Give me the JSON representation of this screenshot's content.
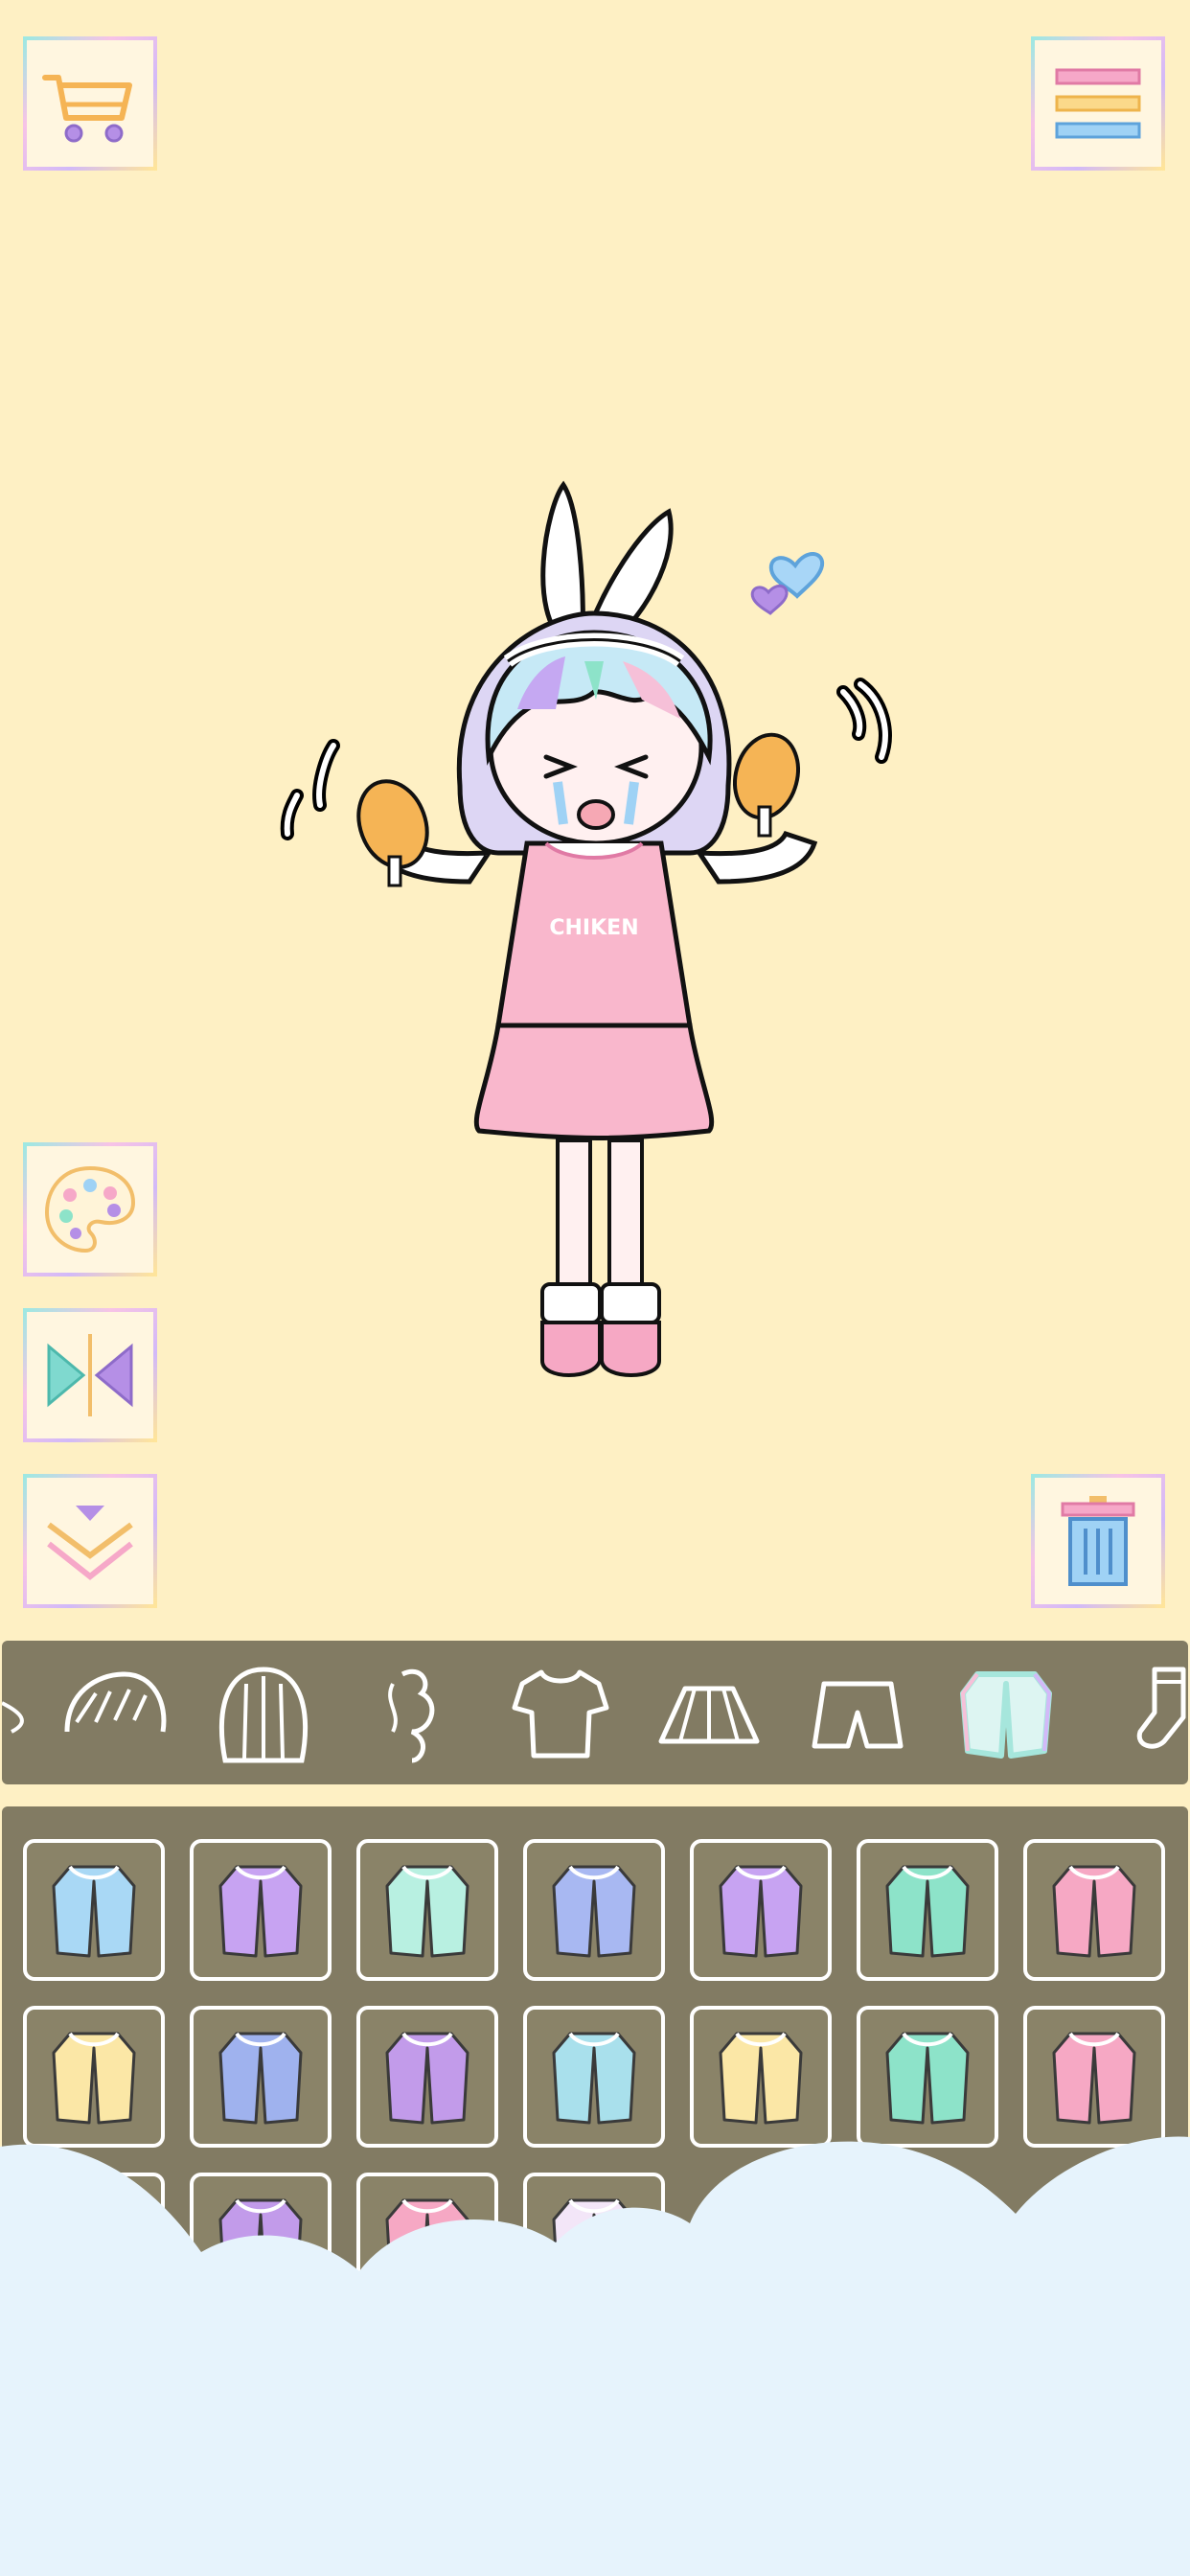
{
  "toolbar": {
    "shop_icon": "cart-icon",
    "menu_icon": "hamburger-menu-icon",
    "palette_icon": "palette-icon",
    "flip_icon": "flip-icon",
    "collapse_icon": "chevron-down-double-icon",
    "trash_icon": "trash-icon"
  },
  "character": {
    "shirt_text": "CHIKEN"
  },
  "categories": [
    {
      "name": "bangs",
      "icon": "bangs-hair-icon"
    },
    {
      "name": "hair-back",
      "icon": "back-hair-icon"
    },
    {
      "name": "hair-accessory",
      "icon": "ponytail-hair-icon"
    },
    {
      "name": "top",
      "icon": "tshirt-icon"
    },
    {
      "name": "skirt",
      "icon": "skirt-icon"
    },
    {
      "name": "shorts",
      "icon": "shorts-icon"
    },
    {
      "name": "outerwear",
      "icon": "jacket-icon",
      "selected": true
    },
    {
      "name": "socks",
      "icon": "socks-icon"
    }
  ],
  "items": [
    {
      "icon": "jacket-item-icon",
      "color": "#A9D8F5"
    },
    {
      "icon": "jacket-item-icon",
      "color": "#C7A3F2"
    },
    {
      "icon": "jacket-item-icon",
      "color": "#B8F0E1"
    },
    {
      "icon": "cape-item-icon",
      "color": "#A8B8F2"
    },
    {
      "icon": "jacket-item-icon",
      "color": "#C7A3F2"
    },
    {
      "icon": "scarf-item-icon",
      "color": "#8DE3C9"
    },
    {
      "icon": "bag-item-icon",
      "color": "#F6A8C4"
    },
    {
      "icon": "coat-item-icon",
      "color": "#FBE7A6"
    },
    {
      "icon": "denim-jacket-item-icon",
      "color": "#9FB2EE"
    },
    {
      "icon": "coat-item-icon",
      "color": "#C29BEA"
    },
    {
      "icon": "raincoat-item-icon",
      "color": "#A9E0EC"
    },
    {
      "icon": "hoodie-item-icon",
      "color": "#FBE7A6"
    },
    {
      "icon": "coat-item-icon",
      "color": "#8DE3C9"
    },
    {
      "icon": "coat-item-icon",
      "color": "#F6A8C4"
    },
    {
      "icon": "coat-item-icon",
      "color": "#FBE7A6"
    },
    {
      "icon": "coat-item-icon",
      "color": "#C29BEA"
    },
    {
      "icon": "coat-item-icon",
      "color": "#F6A8C4"
    },
    {
      "icon": "coat-item-icon",
      "color": "#F3E6F8"
    }
  ],
  "colors": {
    "background": "#FEF0C4",
    "panel": "#827B63",
    "cloud": "#E6F3FC"
  }
}
